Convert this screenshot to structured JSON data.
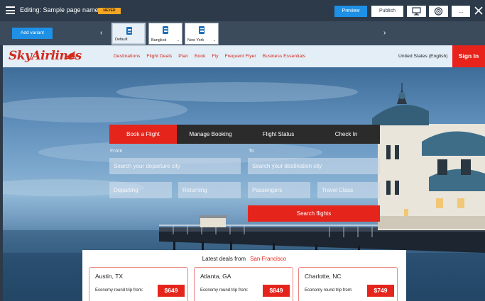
{
  "editor": {
    "title": "Editing: Sample page name",
    "badge": "NEVER",
    "preview": "Preview",
    "publish": "Publish",
    "more": "...",
    "icons": {
      "menu": "hamburger-icon",
      "device": "desktop-icon",
      "target": "target-icon",
      "close": "close-icon"
    }
  },
  "variants": {
    "add": "Add variant",
    "prev": "‹",
    "next": "›",
    "items": [
      {
        "label": "Default"
      },
      {
        "label": "Bangkok"
      },
      {
        "label": "New York"
      }
    ]
  },
  "site": {
    "logo": "SkyAirlines",
    "nav": [
      "Destinations",
      "Flight Deals",
      "Plan",
      "Book",
      "Fly",
      "Frequent Flyer",
      "Business Essentials"
    ],
    "locale": "United States (English)",
    "signin": "Sign In"
  },
  "booking": {
    "tabs": [
      "Book a Flight",
      "Manage Booking",
      "Flight Status",
      "Check In"
    ],
    "from_label": "From",
    "to_label": "To",
    "departure_placeholder": "Search your departure city",
    "destination_placeholder": "Search your destination city",
    "departing_placeholder": "Departing",
    "returning_placeholder": "Returning",
    "passengers_placeholder": "Passengers",
    "class_placeholder": "Travel Class",
    "search": "Search flights"
  },
  "deals": {
    "title": "Latest deals from",
    "city": "San Francisco",
    "cards": [
      {
        "city": "Austin, TX",
        "from": "Economy round trip from:",
        "price": "$649"
      },
      {
        "city": "Atlanta, GA",
        "from": "Economy round trip from:",
        "price": "$849"
      },
      {
        "city": "Charlotte, NC",
        "from": "Economy round trip from:",
        "price": "$749"
      }
    ]
  },
  "colors": {
    "brand_red": "#e5251c",
    "editor_dark": "#2c3a4a",
    "editor_blue": "#1e90e6",
    "badge": "#f5a623"
  }
}
